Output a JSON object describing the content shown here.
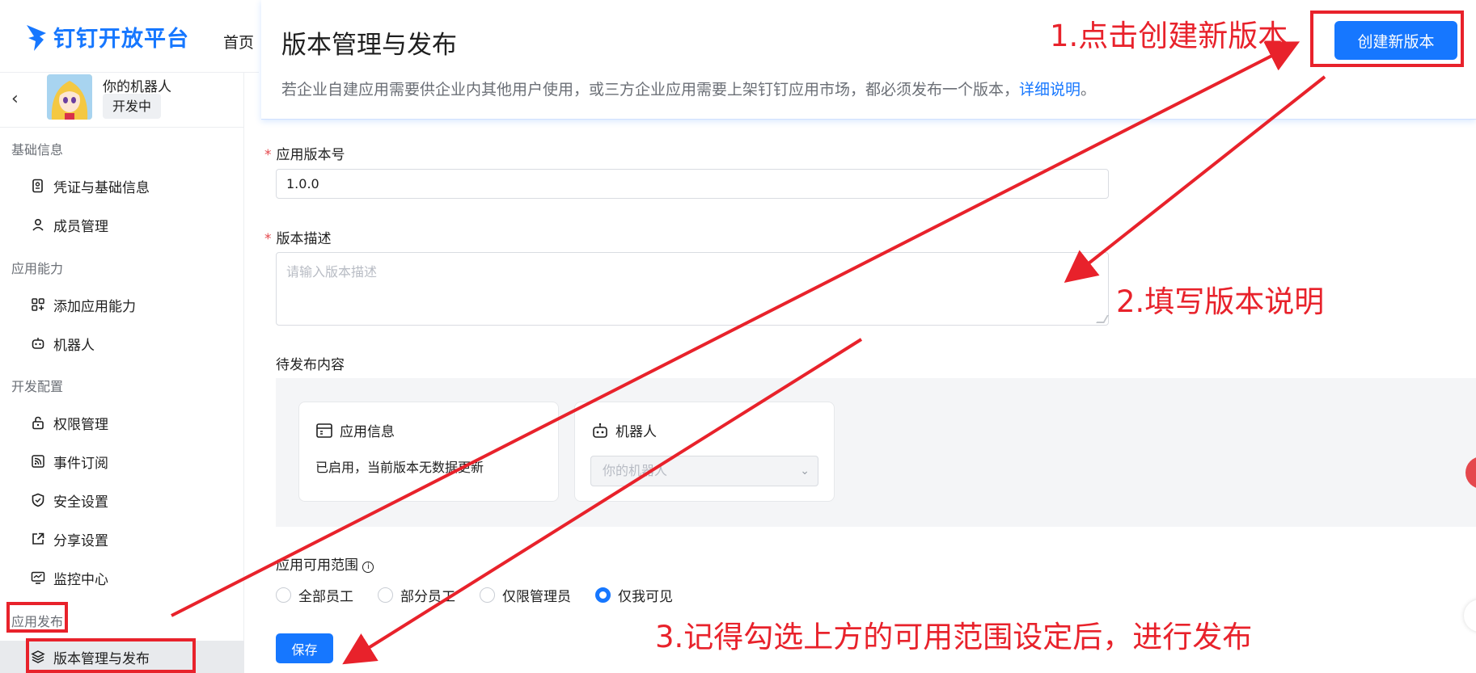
{
  "brand": {
    "logo_text": "钉钉开放平台",
    "nav_home": "首页"
  },
  "app": {
    "name": "你的机器人",
    "status": "开发中"
  },
  "sidebar": {
    "groups": [
      {
        "label": "基础信息",
        "items": [
          {
            "label": "凭证与基础信息",
            "icon": "credential-icon"
          },
          {
            "label": "成员管理",
            "icon": "user-icon"
          }
        ]
      },
      {
        "label": "应用能力",
        "items": [
          {
            "label": "添加应用能力",
            "icon": "apps-add-icon"
          },
          {
            "label": "机器人",
            "icon": "robot-icon"
          }
        ]
      },
      {
        "label": "开发配置",
        "items": [
          {
            "label": "权限管理",
            "icon": "lock-icon"
          },
          {
            "label": "事件订阅",
            "icon": "rss-icon"
          },
          {
            "label": "安全设置",
            "icon": "shield-icon"
          },
          {
            "label": "分享设置",
            "icon": "share-icon"
          },
          {
            "label": "监控中心",
            "icon": "monitor-icon"
          }
        ]
      },
      {
        "label": "应用发布",
        "items": [
          {
            "label": "版本管理与发布",
            "icon": "layers-icon",
            "active": true
          }
        ]
      }
    ]
  },
  "header": {
    "title": "版本管理与发布",
    "description": "若企业自建应用需要供企业内其他用户使用，或三方企业应用需要上架钉钉应用市场，都必须发布一个版本，",
    "link": "详细说明",
    "description_end": "。",
    "create_button": "创建新版本"
  },
  "form": {
    "version_label": "应用版本号",
    "version_value": "1.0.0",
    "desc_label": "版本描述",
    "desc_placeholder": "请输入版本描述",
    "pending_label": "待发布内容",
    "cards": [
      {
        "title": "应用信息",
        "text": "已启用，当前版本无数据更新",
        "icon": "app-window-icon"
      },
      {
        "title": "机器人",
        "select_value": "你的机器人",
        "icon": "robot-icon"
      }
    ],
    "scope_label": "应用可用范围",
    "scope_options": [
      {
        "label": "全部员工",
        "checked": false
      },
      {
        "label": "部分员工",
        "checked": false
      },
      {
        "label": "仅限管理员",
        "checked": false
      },
      {
        "label": "仅我可见",
        "checked": true
      }
    ],
    "save_button": "保存"
  },
  "annotations": {
    "step1": "1.点击创建新版本",
    "step2": "2.填写版本说明",
    "step3": "3.记得勾选上方的可用范围设定后，进行发布"
  },
  "colors": {
    "accent": "#1677ff",
    "annotation": "#e8222b",
    "required": "#e5484d"
  }
}
